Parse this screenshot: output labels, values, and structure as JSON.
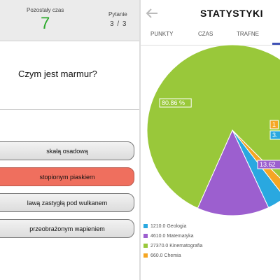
{
  "quiz": {
    "time_label": "Pozostały czas",
    "time_value": "7",
    "question_label": "Pytanie",
    "question_value": "3 / 3",
    "question_text": "Czym jest marmur?",
    "answers": [
      {
        "label": "skałą osadową",
        "state": "default"
      },
      {
        "label": "stopionym piaskiem",
        "state": "wrong"
      },
      {
        "label": "lawą zastygłą pod wulkanem",
        "state": "default"
      },
      {
        "label": "przeobrażonym wapieniem",
        "state": "default"
      }
    ]
  },
  "stats": {
    "title": "STATYSTYKI",
    "back_icon": "arrow-left-icon",
    "tabs": [
      "PUNKTY",
      "CZAS",
      "TRAFNE"
    ],
    "active_tab_color": "#3f51b5"
  },
  "chart_data": {
    "type": "pie",
    "slices": [
      {
        "label": "1210.0 Geologia",
        "value": 1210.0,
        "color": "#29a8e0"
      },
      {
        "label": "4610.0 Matematyka",
        "value": 4610.0,
        "color": "#9c5fcf"
      },
      {
        "label": "27370.0 Kinematografia",
        "value": 27370.0,
        "color": "#99c83a"
      },
      {
        "label": "660.0 Chemia",
        "value": 660.0,
        "color": "#f5a623"
      }
    ],
    "data_labels": [
      "80.86 %",
      "13.62",
      "3.",
      "1"
    ],
    "legend_position": "bottom-left"
  }
}
